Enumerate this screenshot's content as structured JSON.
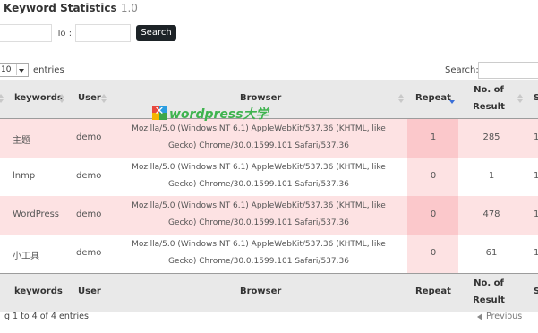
{
  "page": {
    "title": "Keyword Statistics",
    "version": "1.0"
  },
  "filters": {
    "from_value": "",
    "to_label": "To :",
    "to_value": "",
    "search_button": "Search"
  },
  "length_menu": {
    "value": "10",
    "suffix": "entries"
  },
  "table_search": {
    "label": "Search:",
    "value": ""
  },
  "table": {
    "headers": {
      "keywords": "keywords",
      "user": "User",
      "browser": "Browser",
      "repeat": "Repeat",
      "results_line1": "No. of",
      "results_line2": "Result",
      "extra": "S"
    },
    "sorted_column": "Repeat",
    "sort_direction": "descending",
    "rows": [
      {
        "keyword": "主题",
        "user": "demo",
        "browser_line1": "Mozilla/5.0 (Windows NT 6.1) AppleWebKit/537.36 (KHTML, like",
        "browser_line2": "Gecko) Chrome/30.0.1599.101 Safari/537.36",
        "repeat": "1",
        "results": "285",
        "extra": "1"
      },
      {
        "keyword": "lnmp",
        "user": "demo",
        "browser_line1": "Mozilla/5.0 (Windows NT 6.1) AppleWebKit/537.36 (KHTML, like",
        "browser_line2": "Gecko) Chrome/30.0.1599.101 Safari/537.36",
        "repeat": "0",
        "results": "1",
        "extra": "1"
      },
      {
        "keyword": "WordPress",
        "user": "demo",
        "browser_line1": "Mozilla/5.0 (Windows NT 6.1) AppleWebKit/537.36 (KHTML, like",
        "browser_line2": "Gecko) Chrome/30.0.1599.101 Safari/537.36",
        "repeat": "0",
        "results": "478",
        "extra": "1"
      },
      {
        "keyword": "小工具",
        "user": "demo",
        "browser_line1": "Mozilla/5.0 (Windows NT 6.1) AppleWebKit/537.36 (KHTML, like",
        "browser_line2": "Gecko) Chrome/30.0.1599.101 Safari/537.36",
        "repeat": "0",
        "results": "61",
        "extra": "1"
      }
    ]
  },
  "footer": {
    "info": "g 1 to 4 of 4 entries",
    "previous": "Previous"
  },
  "watermark": {
    "text": "wordpress大学",
    "colors": {
      "text": "#3fb34f",
      "logo": [
        "#e7493f",
        "#2a9de0",
        "#f4b400",
        "#3da64a"
      ]
    }
  },
  "colors": {
    "odd_row": "#fde2e3",
    "sorted_column_odd": "#fbc8cb",
    "header_bg": "#e9e9e9",
    "button_bg": "#1d2327",
    "sort_indicator": "#3a6fd8"
  }
}
